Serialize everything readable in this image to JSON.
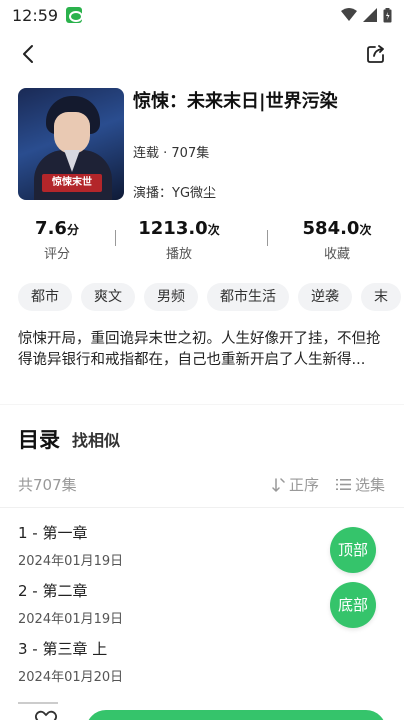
{
  "status_bar": {
    "time": "12:59",
    "icons": [
      "wifi-icon",
      "signal-icon",
      "battery-icon"
    ]
  },
  "book": {
    "title": "惊悚：未来末日|世界污染",
    "status": "连载 · 707集",
    "narrator": "演播：YG微尘",
    "cover_badge": "惊悚末世"
  },
  "stats": [
    {
      "value": "7.6",
      "unit": "分",
      "label": "评分"
    },
    {
      "value": "1213.0",
      "unit": "次",
      "label": "播放"
    },
    {
      "value": "584.0",
      "unit": "次",
      "label": "收藏"
    }
  ],
  "tags": [
    "都市",
    "爽文",
    "男频",
    "都市生活",
    "逆袭",
    "末"
  ],
  "synopsis": "惊悚开局，重回诡异末世之初。人生好像开了挂，不但抢得诡异银行和戒指都在，自己也重新开启了人生新得...",
  "catalog": {
    "title": "目录",
    "similar": "找相似",
    "count": "共707集",
    "sort_label": "正序",
    "select_label": "选集"
  },
  "episodes": [
    {
      "title": "1 - 第一章",
      "date": "2024年01月19日"
    },
    {
      "title": "2 - 第二章",
      "date": "2024年01月19日"
    },
    {
      "title": "3 - 第三章 上",
      "date": "2024年01月20日"
    }
  ],
  "float_buttons": {
    "top": "顶部",
    "bottom": "底部"
  },
  "colors": {
    "accent": "#35c46b",
    "tag_bg": "#f2f3f5"
  }
}
